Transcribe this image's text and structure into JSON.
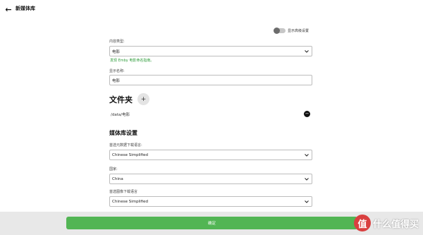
{
  "header": {
    "back_icon": "arrow-left-icon",
    "title": "新媒体库"
  },
  "advanced": {
    "toggle_label": "显示高级设置",
    "enabled": false
  },
  "form": {
    "content_type": {
      "label": "内容类型:",
      "value": "电影",
      "help": "发现 Emby 电影命名指南。"
    },
    "display_name": {
      "label": "显示名称:",
      "value": "电影"
    }
  },
  "folders": {
    "title": "文件夹",
    "add_label": "+",
    "items": [
      {
        "path": "/data/电影"
      }
    ]
  },
  "library_settings": {
    "title": "媒体库设置",
    "metadata_language": {
      "label": "首选元数据下载语言:",
      "value": "Chinese Simplified"
    },
    "country": {
      "label": "国家:",
      "value": "China"
    },
    "image_language": {
      "label": "首选图像下载语言",
      "value": "Chinese Simplified"
    }
  },
  "footer": {
    "ok_label": "确定"
  },
  "watermark": {
    "logo_char": "值",
    "text": "什么值得买"
  }
}
